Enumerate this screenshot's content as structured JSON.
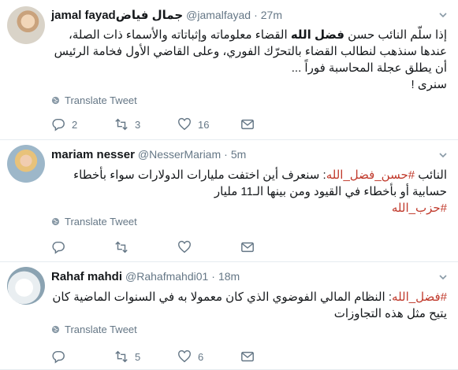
{
  "tweets": [
    {
      "name": "jamal fayadجمال فياض",
      "handle": "@jamalfayad",
      "time": "27m",
      "lines": [
        "إذا سلّم النائب حسن ",
        "فضل الله",
        " القضاء معلوماته وإثباتاته والأسماء ذات الصلة، عندها سنذهب لنطالب القضاء بالتحرّك الفوري، وعلى القاضي الأول فخامة الرئيس أن يطلق عجلة المحاسبة فوراً ...",
        "سنرى !"
      ],
      "translate": "Translate Tweet",
      "replies": "2",
      "retweets": "3",
      "likes": "16"
    },
    {
      "name": "mariam nesser",
      "handle": "@NesserMariam",
      "time": "5m",
      "lines": [
        "النائب ",
        "#حسن_فضل_الله",
        ": سنعرف أين اختفت مليارات الدولارات سواء بأخطاء حسابية أو بأخطاء في القيود ومن بينها الـ11 مليار",
        "#حزب_الله"
      ],
      "translate": "Translate Tweet",
      "replies": "",
      "retweets": "",
      "likes": ""
    },
    {
      "name": "Rahaf mahdi",
      "handle": "@Rahafmahdi01",
      "time": "18m",
      "lines": [
        "#فضل_الله",
        ": النظام المالي الفوضوي الذي كان معمولا به في السنوات الماضية كان يتيح مثل هذه التجاوزات"
      ],
      "translate": "Translate Tweet",
      "replies": "",
      "retweets": "5",
      "likes": "6"
    }
  ],
  "separator": "·"
}
